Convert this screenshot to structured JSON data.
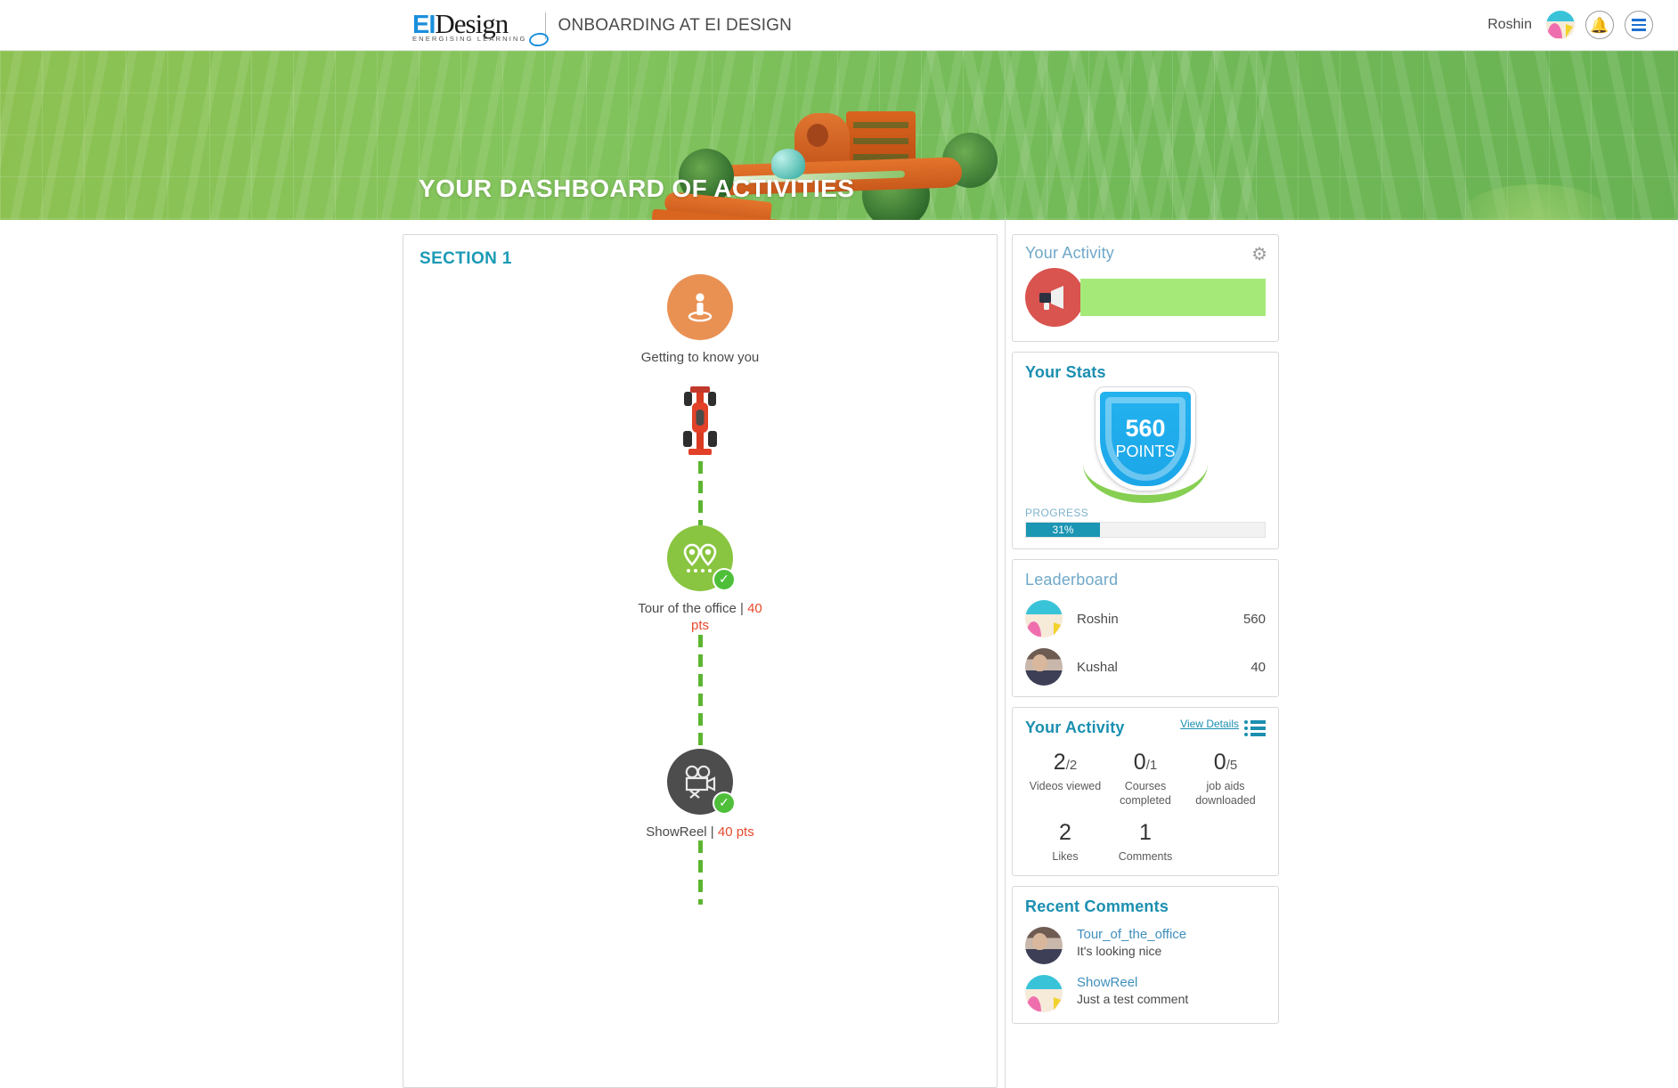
{
  "header": {
    "logo_ei": "EI",
    "logo_design": "Design",
    "logo_tagline": "ENERGISING LEARNING",
    "course_title": "ONBOARDING AT EI DESIGN",
    "user_name": "Roshin",
    "bell_icon": "bell-icon",
    "menu_icon": "hamburger-icon"
  },
  "banner": {
    "title": "YOUR DASHBOARD OF ACTIVITIES"
  },
  "section": {
    "title": "SECTION 1",
    "nodes": [
      {
        "label": "Getting to  know you",
        "points": "",
        "icon": "person-on-platform-icon",
        "completed": false,
        "color": "#e99153"
      },
      {
        "label": "Tour of the office | ",
        "points": "40 pts",
        "icon": "map-pins-icon",
        "completed": true,
        "color": "#89c540"
      },
      {
        "label": "ShowReel | ",
        "points": "40 pts",
        "icon": "movie-camera-icon",
        "completed": true,
        "color": "#4d4d4d"
      }
    ]
  },
  "sidebar": {
    "activity_header": {
      "title": "Your Activity",
      "gear_icon": "gear-icon",
      "announcement_icon": "megaphone-icon"
    },
    "stats": {
      "title": "Your Stats",
      "points_value": "560",
      "points_label": "POINTS",
      "progress_label": "PROGRESS",
      "progress_value": "31%",
      "progress_percent": 31
    },
    "leaderboard": {
      "title": "Leaderboard",
      "rows": [
        {
          "name": "Roshin",
          "score": "560"
        },
        {
          "name": "Kushal",
          "score": "40"
        }
      ]
    },
    "activity": {
      "title": "Your Activity",
      "view_details": "View Details",
      "list_icon": "list-icon",
      "stats": [
        {
          "value": "2",
          "total": "/2",
          "label": "Videos viewed"
        },
        {
          "value": "0",
          "total": "/1",
          "label": "Courses completed"
        },
        {
          "value": "0",
          "total": "/5",
          "label": "job aids downloaded"
        }
      ],
      "stats2": [
        {
          "value": "2",
          "total": "",
          "label": "Likes"
        },
        {
          "value": "1",
          "total": "",
          "label": "Comments"
        },
        {
          "value": "",
          "total": "",
          "label": ""
        }
      ]
    },
    "comments": {
      "title": "Recent Comments",
      "rows": [
        {
          "title": "Tour_of_the_office",
          "text": "It's looking nice"
        },
        {
          "title": "ShowReel",
          "text": "Just a test comment"
        }
      ]
    }
  },
  "colors": {
    "accent_teal": "#1b8fb0",
    "banner_green": "#84c45c",
    "points_red": "#e8492d",
    "progress_fill": "#1b96b3"
  }
}
